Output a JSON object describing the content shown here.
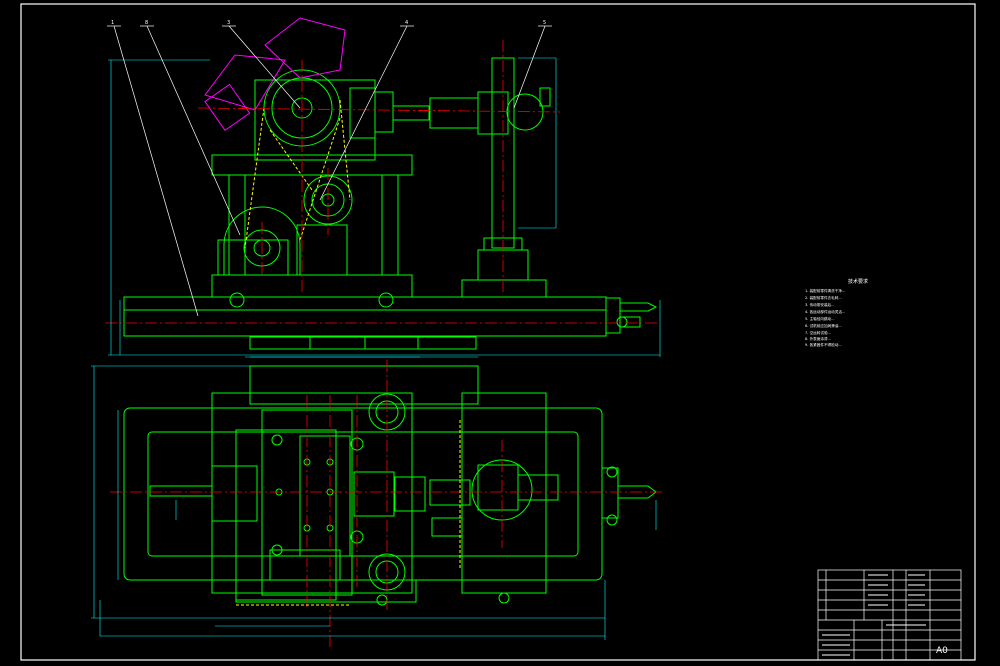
{
  "balloons": [
    "1",
    "8",
    "3",
    "4",
    "5"
  ],
  "tech_requirements": {
    "title": "技术要求",
    "lines": [
      "1. 装配前零件清洗干净...",
      "2. 装配前零件去毛刺...",
      "3. 传动带安装后...",
      "4. 各运动部件运动灵活...",
      "5. 主轴径向跳动...",
      "6. 试机前应加润滑油...",
      "7. 空运转试验...",
      "8. 外表面涂漆...",
      "9. 各紧固件不得松动..."
    ]
  },
  "title_block": {
    "sheet_size": "A0"
  },
  "colors": {
    "background": "#000000",
    "outline": "#00ff00",
    "centerline": "#ff0000",
    "dimension": "#00ffff",
    "leader": "#ffffff",
    "motor": "#ff00ff",
    "hidden": "#ffff00",
    "frame": "#ffffff"
  }
}
